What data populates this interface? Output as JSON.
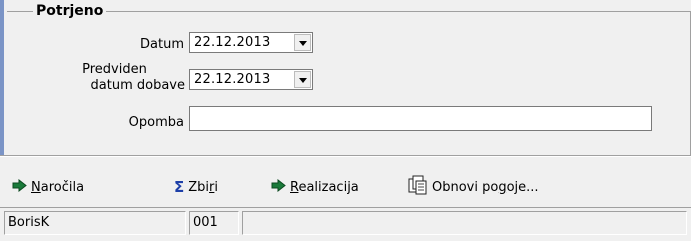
{
  "group": {
    "title": "Potrjeno"
  },
  "fields": {
    "datum": {
      "label": "Datum",
      "value": "22.12.2013"
    },
    "predviden": {
      "label_line1": "Predviden",
      "label_line2": "datum dobave",
      "value": "22.12.2013"
    },
    "opomba": {
      "label": "Opomba",
      "value": ""
    }
  },
  "toolbar": {
    "narocila": {
      "label_u": "N",
      "label_rest": "aročila",
      "icon": "arrow-right-icon"
    },
    "zbiri": {
      "label_pre": "Zbi",
      "label_u": "r",
      "label_rest": "i",
      "icon": "sigma-icon"
    },
    "realizacija": {
      "label_u": "R",
      "label_rest": "ealizacija",
      "icon": "arrow-right-icon"
    },
    "obnovi": {
      "label_pre": "Obnovi po",
      "label_u": "g",
      "label_rest": "oje...",
      "icon": "documents-icon"
    }
  },
  "status": {
    "user": "BorisK",
    "code": "001",
    "info": ""
  },
  "colors": {
    "accent": "#7b94c6",
    "arrow": "#1a7a3a",
    "sigma": "#1d3fa8"
  }
}
